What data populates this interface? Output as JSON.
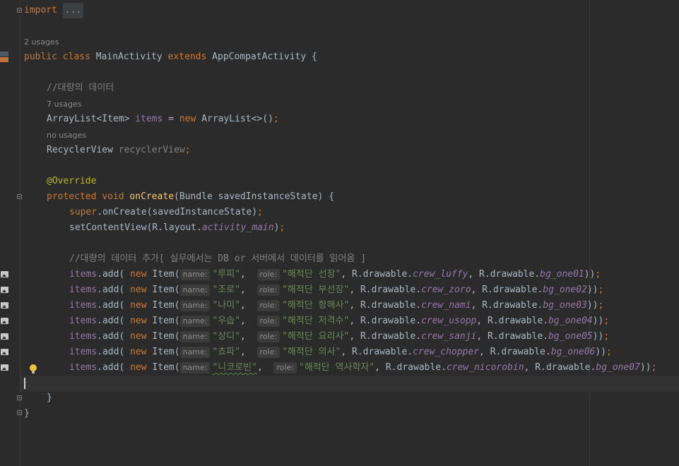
{
  "code": {
    "import_kw": "import",
    "import_fold": "...",
    "class_usages": "2 usages",
    "class_decl": {
      "public": "public",
      "class": "class",
      "name": "MainActivity",
      "extends": "extends",
      "parent": "AppCompatActivity",
      "brace": " {"
    },
    "comment_data": "//대량의 데이터",
    "items_usages": "7 usages",
    "items_decl": {
      "type": "ArrayList<Item> ",
      "name": "items",
      "eq": " = ",
      "new": "new",
      "rest": " ArrayList<>()",
      "semi": ";"
    },
    "rv_usages": "no usages",
    "rv_decl": {
      "type": "RecyclerView ",
      "name": "recyclerView",
      "semi": ";"
    },
    "override": "@Override",
    "oncreate_decl": {
      "protected": "protected",
      "void": "void",
      "name": "onCreate",
      "params": "(Bundle savedInstanceState) {"
    },
    "super_call": {
      "super": "super",
      "rest": ".onCreate(savedInstanceState)",
      "semi": ";"
    },
    "setcontent": {
      "pre": "setContentView(R.layout.",
      "field": "activity_main",
      "post": ")",
      "semi": ";"
    },
    "comment_add": "//대량의 데이터 추가[ 실무에서는 DB or 서버에서 데이터를 읽어옴 ]",
    "hint_name": "name:",
    "hint_role": "role:",
    "new_kw": "new",
    "items_field": "items",
    "add_call": ".add( ",
    "item_ctor": " Item(",
    "drawable_prefix": "R.drawable.",
    "crew_rows": [
      {
        "name": "\"루피\"",
        "role": "\"해적단 선장\"",
        "crew": "crew_luffy",
        "bg": "bg_one01"
      },
      {
        "name": "\"조로\"",
        "role": "\"해적단 부선장\"",
        "crew": "crew_zoro",
        "bg": "bg_one02"
      },
      {
        "name": "\"나미\"",
        "role": "\"해적단 항해사\"",
        "crew": "crew_nami",
        "bg": "bg_one03"
      },
      {
        "name": "\"우솝\"",
        "role": "\"해적단 저격수\"",
        "crew": "crew_usopp",
        "bg": "bg_one04"
      },
      {
        "name": "\"상디\"",
        "role": "\"해적단 요리사\"",
        "crew": "crew_sanji",
        "bg": "bg_one05"
      },
      {
        "name": "\"쵸파\"",
        "role": "\"해적단 의사\"",
        "crew": "crew_chopper",
        "bg": "bg_one06"
      },
      {
        "name": "\"니코로빈\"",
        "role": "\"해적단 역사학자\"",
        "crew": "crew_nicorobin",
        "bg": "bg_one07"
      }
    ],
    "close_method": "}",
    "close_class": "}"
  },
  "colors": {
    "background": "#2b2b2b",
    "keyword": "#cc7832",
    "string": "#6a8759",
    "field": "#9876aa",
    "method": "#ffc66d",
    "comment": "#808080",
    "annotation": "#bbb529"
  }
}
